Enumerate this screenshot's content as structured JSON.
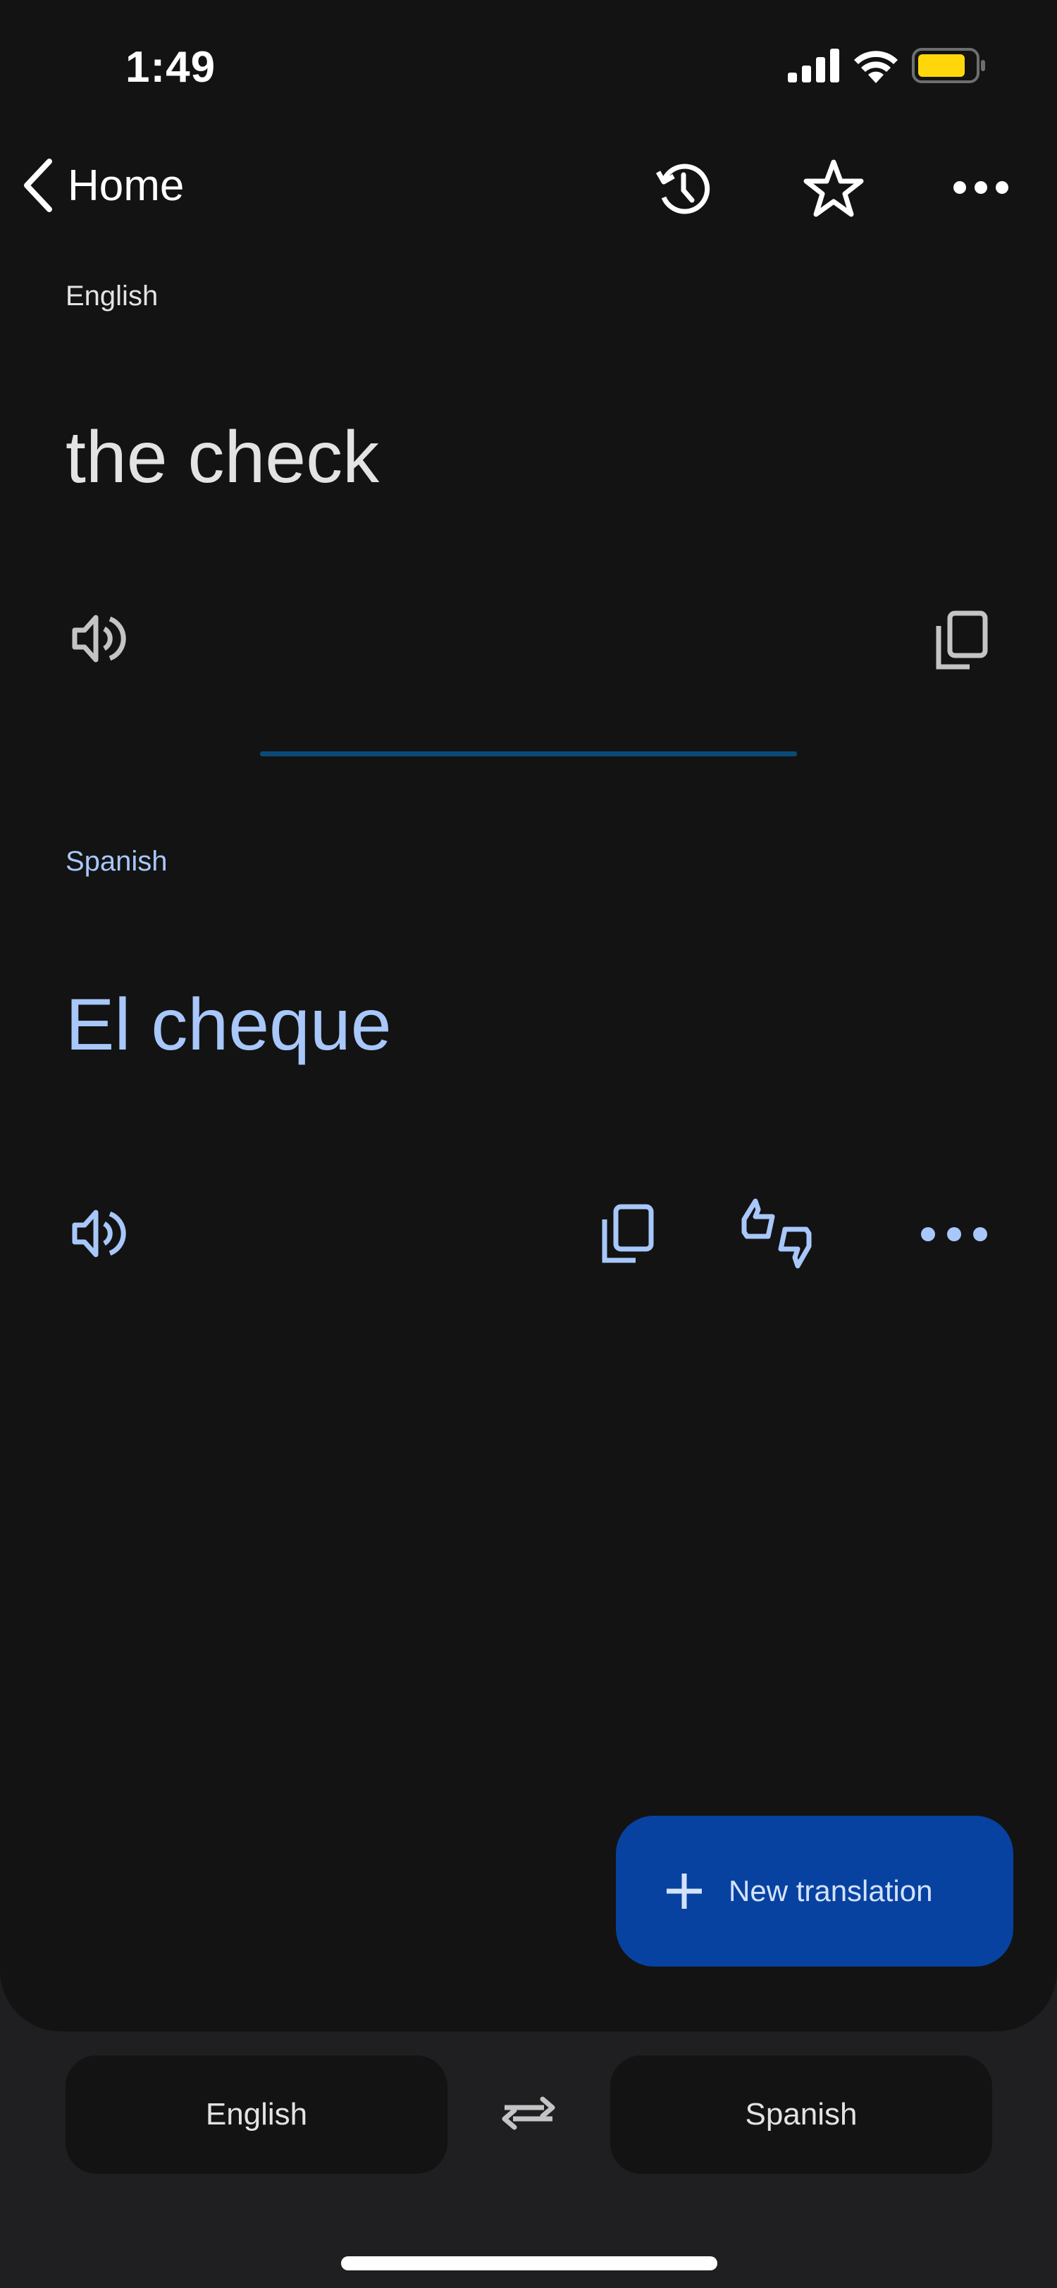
{
  "status_bar": {
    "time": "1:49",
    "battery_color": "#ffd60a"
  },
  "nav": {
    "back_label": "Home",
    "icons": [
      "history-icon",
      "star-icon",
      "more-icon"
    ]
  },
  "source": {
    "language": "English",
    "text": "the check"
  },
  "target": {
    "language": "Spanish",
    "text": "El cheque"
  },
  "fab": {
    "label": "New translation"
  },
  "language_bar": {
    "source_language": "English",
    "target_language": "Spanish"
  },
  "colors": {
    "accent": "#a8c7fa",
    "fab_bg": "#0842a0",
    "fab_text": "#d3e3fd",
    "background": "#131313"
  }
}
